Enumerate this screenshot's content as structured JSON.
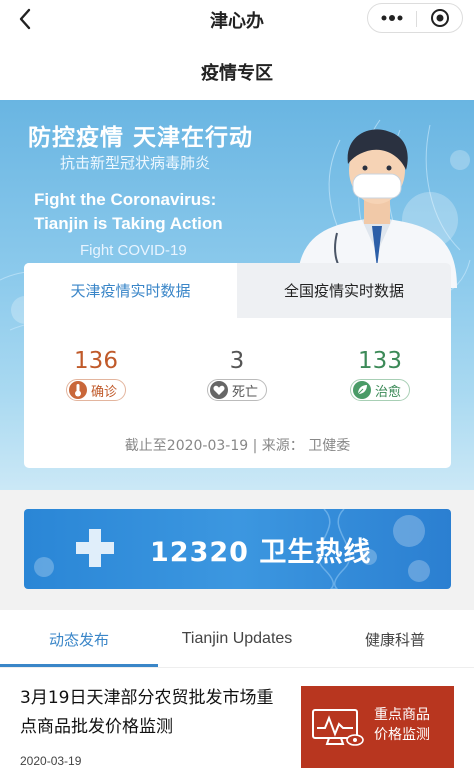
{
  "app": {
    "title": "津心办"
  },
  "page": {
    "title": "疫情专区"
  },
  "banner": {
    "title_cn": "防控疫情 天津在行动",
    "subtitle_cn": "抗击新型冠状病毒肺炎",
    "title_en_line1": "Fight the Coronavirus:",
    "title_en_line2": "Tianjin is Taking Action",
    "subtitle_en": "Fight COVID-19"
  },
  "data_card": {
    "tabs": [
      "天津疫情实时数据",
      "全国疫情实时数据"
    ],
    "stats": [
      {
        "value": "136",
        "label": "确诊",
        "icon": "thermometer-icon",
        "color": "#c05a2a"
      },
      {
        "value": "3",
        "label": "死亡",
        "icon": "heart-icon",
        "color": "#555555"
      },
      {
        "value": "133",
        "label": "治愈",
        "icon": "leaf-icon",
        "color": "#3c8a58"
      }
    ],
    "footnote": "截止至2020-03-19 | 来源： 卫健委"
  },
  "hotline": {
    "text": "12320 卫生热线"
  },
  "section_tabs": [
    "动态发布",
    "Tianjin Updates",
    "健康科普"
  ],
  "article": {
    "title": "3月19日天津部分农贸批发市场重点商品批发价格监测",
    "date": "2020-03-19",
    "thumb_text_line1": "重点商品",
    "thumb_text_line2": "价格监测"
  },
  "colors": {
    "accent": "#3a86c8",
    "thumb_bg": "#b8361f"
  }
}
